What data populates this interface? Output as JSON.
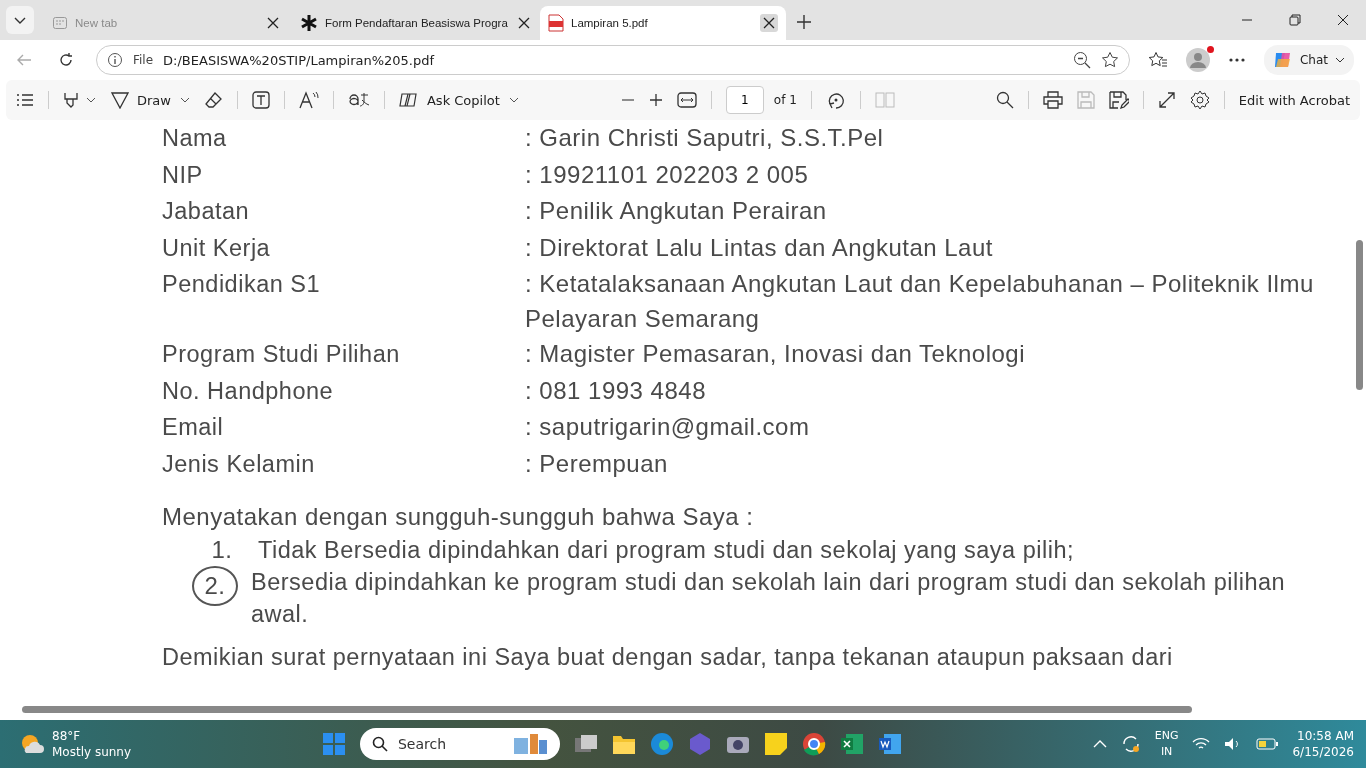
{
  "tabs": [
    {
      "title": "New tab",
      "kind": "newtab",
      "selected": false
    },
    {
      "title": "Form Pendaftaran Beasiswa Progra",
      "kind": "form",
      "selected": false
    },
    {
      "title": "Lampiran 5.pdf",
      "kind": "pdf",
      "selected": true
    }
  ],
  "address_bar": {
    "scheme": "File",
    "url": "D:/BEASISWA%20STIP/Lampiran%205.pdf"
  },
  "browser_actions": {
    "chat": "Chat"
  },
  "pdf_toolbar": {
    "draw": "Draw",
    "ask_copilot": "Ask Copilot",
    "page": "1",
    "page_of": "of 1",
    "edit": "Edit with Acrobat"
  },
  "document": {
    "fields": [
      {
        "label": "Nama",
        "value": ": Garin Christi Saputri, S.S.T.Pel"
      },
      {
        "label": "NIP",
        "value": ": 19921101 202203 2 005"
      },
      {
        "label": "Jabatan",
        "value": ": Penilik Angkutan Perairan"
      },
      {
        "label": "Unit Kerja",
        "value": ": Direktorat Lalu Lintas dan Angkutan Laut"
      },
      {
        "label": "Pendidikan S1",
        "value": ": Ketatalaksanaan Angkutan Laut dan Kepelabuhanan – Politeknik Ilmu Pelayaran Semarang"
      },
      {
        "label": "Program Studi Pilihan",
        "value": ": Magister Pemasaran, Inovasi dan Teknologi"
      },
      {
        "label": "No. Handphone",
        "value": ": 081 1993 4848"
      },
      {
        "label": "Email",
        "value": ": saputrigarin@gmail.com"
      },
      {
        "label": "Jenis Kelamin",
        "value": ": Perempuan"
      }
    ],
    "statement": "Menyatakan dengan sungguh-sungguh bahwa Saya :",
    "options": [
      {
        "number": "1.",
        "text": "Tidak Bersedia dipindahkan dari program studi dan sekolaj yang saya pilih;",
        "circled": false
      },
      {
        "number": "2.",
        "text": "Bersedia dipindahkan ke program studi dan sekolah lain dari program studi dan sekolah pilihan awal.",
        "circled": true
      }
    ],
    "closing": "Demikian surat pernyataan ini Saya buat dengan sadar, tanpa tekanan ataupun paksaan dari"
  },
  "taskbar": {
    "temperature": "88°F",
    "weather": "Mostly sunny",
    "search": "Search",
    "language": "ENG",
    "region": "IN",
    "time": "10:58 AM",
    "date": "6/15/2026"
  }
}
